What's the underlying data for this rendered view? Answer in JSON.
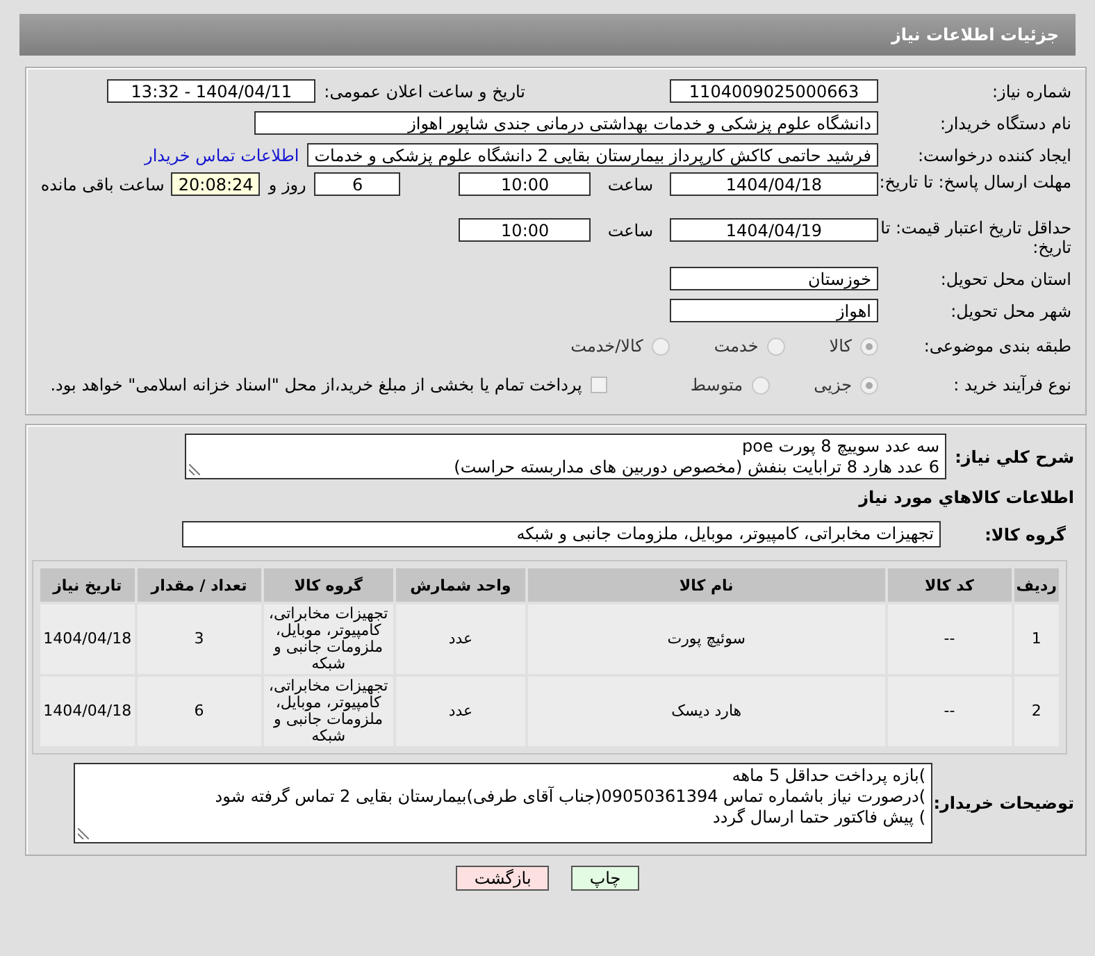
{
  "header": {
    "title": "جزئیات اطلاعات نیاز"
  },
  "need_number": {
    "label": "شماره نیاز:",
    "value": "1104009025000663"
  },
  "announce": {
    "label": "تاریخ و ساعت اعلان عمومی:",
    "value": "1404/04/11 - 13:32"
  },
  "buyer_org": {
    "label": "نام دستگاه خریدار:",
    "value": "دانشگاه علوم پزشکی و خدمات بهداشتی درمانی جندی شاپور اهواز"
  },
  "requester": {
    "label": "ایجاد کننده درخواست:",
    "value": "فرشید حاتمی کاکش کارپرداز بیمارستان بقایی 2 دانشگاه علوم پزشکی و خدمات",
    "link": "اطلاعات تماس خریدار"
  },
  "reply_deadline": {
    "label": "مهلت ارسال پاسخ: تا تاریخ:",
    "date": "1404/04/18",
    "time_label": "ساعت",
    "time": "10:00",
    "days": "6",
    "days_label": "روز و",
    "remaining": "20:08:24",
    "remaining_label": "ساعت باقی مانده"
  },
  "price_validity": {
    "label": "حداقل تاریخ اعتبار قیمت: تا تاریخ:",
    "date": "1404/04/19",
    "time_label": "ساعت",
    "time": "10:00"
  },
  "province": {
    "label": "استان محل تحویل:",
    "value": "خوزستان"
  },
  "city": {
    "label": "شهر محل تحویل:",
    "value": "اهواز"
  },
  "category": {
    "label": "طبقه بندی موضوعی:",
    "options": [
      {
        "label": "کالا",
        "selected": true
      },
      {
        "label": "خدمت",
        "selected": false
      },
      {
        "label": "کالا/خدمت",
        "selected": false
      }
    ]
  },
  "process": {
    "label": "نوع فرآیند خرید :",
    "options": [
      {
        "label": "جزیی",
        "selected": true
      },
      {
        "label": "متوسط",
        "selected": false
      }
    ],
    "payment_note": {
      "text": "پرداخت تمام یا بخشی از مبلغ خرید،از محل \"اسناد خزانه اسلامی\" خواهد بود.",
      "checked": false
    }
  },
  "description": {
    "label": "شرح کلي نياز:",
    "lines": [
      "سه عدد سوییچ 8 پورت poe",
      "6 عدد هارد 8 ترابایت بنفش (مخصوص دوربین های مداربسته حراست)"
    ]
  },
  "goods": {
    "title": "اطلاعات كالاهاي مورد نياز",
    "group": {
      "label": "گروه کالا:",
      "value": "تجهیزات مخابراتی، کامپیوتر، موبایل، ملزومات جانبی و شبکه"
    },
    "table": {
      "columns": [
        "ردیف",
        "کد کالا",
        "نام کالا",
        "واحد شمارش",
        "گروه کالا",
        "تعداد / مقدار",
        "تاریخ نیاز"
      ],
      "rows": [
        [
          "1",
          "--",
          "سوئیچ پورت",
          "عدد",
          "تجهیزات مخابراتی، کامپیوتر، موبایل، ملزومات جانبی و شبکه",
          "3",
          "1404/04/18"
        ],
        [
          "2",
          "--",
          "هارد دیسک",
          "عدد",
          "تجهیزات مخابراتی، کامپیوتر، موبایل، ملزومات جانبی و شبکه",
          "6",
          "1404/04/18"
        ]
      ]
    }
  },
  "buyer_notes": {
    "label": "توضیحات خریدار:",
    "lines": [
      ")بازه پرداخت حداقل 5 ماهه",
      ")درصورت نیاز باشماره تماس 09050361394(جناب آقای طرفی)بیمارستان بقایی 2 تماس گرفته شود",
      ") پیش فاکتور حتما ارسال گردد"
    ]
  },
  "buttons": [
    {
      "label": "چاپ",
      "kind": "print"
    },
    {
      "label": "بازگشت",
      "kind": "back"
    }
  ]
}
